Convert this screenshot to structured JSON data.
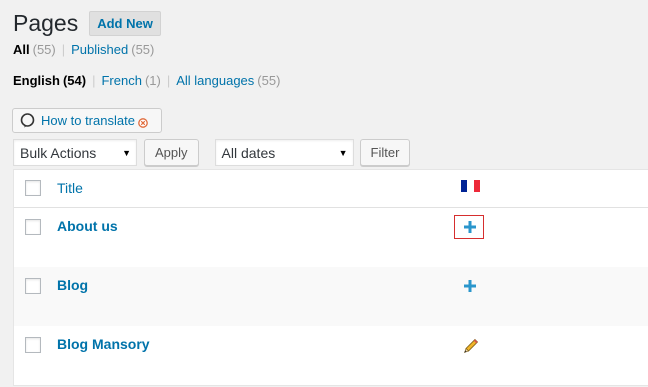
{
  "header": {
    "title": "Pages",
    "add_new_label": "Add New"
  },
  "status_filters": {
    "all_label": "All",
    "all_count": "(55)",
    "published_label": "Published",
    "published_count": "(55)",
    "separator": "|"
  },
  "language_filters": {
    "english_label": "English",
    "english_count": "(54)",
    "french_label": "French",
    "french_count": "(1)",
    "all_languages_label": "All languages",
    "all_languages_count": "(55)",
    "separator": "|"
  },
  "help": {
    "how_to_translate_label": "How to translate"
  },
  "tablenav": {
    "bulk_actions_value": "Bulk Actions",
    "apply_label": "Apply",
    "dates_value": "All dates",
    "filter_label": "Filter"
  },
  "table": {
    "column_title": "Title",
    "language_flag": "french-flag-icon",
    "rows": [
      {
        "title": "About us",
        "action": "add-translation-icon",
        "highlighted": true
      },
      {
        "title": "Blog",
        "action": "add-translation-icon",
        "highlighted": false
      },
      {
        "title": "Blog Mansory",
        "action": "edit-translation-icon",
        "highlighted": false
      }
    ]
  },
  "colors": {
    "link": "#0073aa",
    "highlight_border": "#d62e2e",
    "flag_blue": "#002395",
    "flag_white": "#ffffff",
    "flag_red": "#ed2939"
  }
}
